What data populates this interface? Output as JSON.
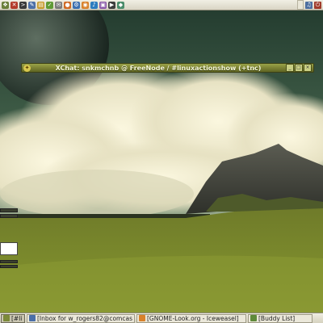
{
  "top_panel": {
    "launchers": [
      {
        "icon": "app-menu-icon",
        "color": "#6a7f3a",
        "glyph": "❖"
      },
      {
        "icon": "tools-icon",
        "color": "#b33b2b",
        "glyph": "✕"
      },
      {
        "icon": "terminal-icon",
        "color": "#3a3a3a",
        "glyph": ">"
      },
      {
        "icon": "editor-icon",
        "color": "#4c6fa8",
        "glyph": "✎"
      },
      {
        "icon": "folder-icon",
        "color": "#c79a2c",
        "glyph": "▤"
      },
      {
        "icon": "checkmark-icon",
        "color": "#5f9a35",
        "glyph": "✓"
      },
      {
        "icon": "mail-icon",
        "color": "#7b7b7b",
        "glyph": "✉"
      },
      {
        "icon": "chat-icon",
        "color": "#d06a24",
        "glyph": "●"
      },
      {
        "icon": "settings-icon",
        "color": "#3b6fb0",
        "glyph": "⚙"
      },
      {
        "icon": "browser-icon",
        "color": "#d9822b",
        "glyph": "◉"
      },
      {
        "icon": "music-icon",
        "color": "#2d7dbf",
        "glyph": "♪"
      },
      {
        "icon": "photo-icon",
        "color": "#8b5aa8",
        "glyph": "▣"
      },
      {
        "icon": "media-icon",
        "color": "#3d3d3d",
        "glyph": "▶"
      },
      {
        "icon": "network-icon",
        "color": "#4a8c6a",
        "glyph": "◆"
      }
    ],
    "clock": "",
    "tray": [
      {
        "icon": "volume-icon",
        "color": "#4d6fa0",
        "glyph": "♫"
      },
      {
        "icon": "power-icon",
        "color": "#a03a2a",
        "glyph": "⏻"
      }
    ]
  },
  "xchat_window": {
    "title": "XChat: snkmchnb @ FreeNode / #linuxactionshow (+tnc)",
    "minimize_label": "_",
    "maximize_label": "□",
    "close_label": "×"
  },
  "taskbar": {
    "tasks": [
      {
        "label": "[#linu...",
        "icon_color": "#7c8a3a",
        "active": true
      },
      {
        "label": "[Inbox for w_rogers82@comcast.net - Ice...",
        "icon_color": "#4c6fa8",
        "active": false
      },
      {
        "label": "[GNOME-Look.org - Iceweasel]",
        "icon_color": "#d9822b",
        "active": false
      },
      {
        "label": "[Buddy List]",
        "icon_color": "#5f8a3a",
        "active": false
      }
    ]
  }
}
